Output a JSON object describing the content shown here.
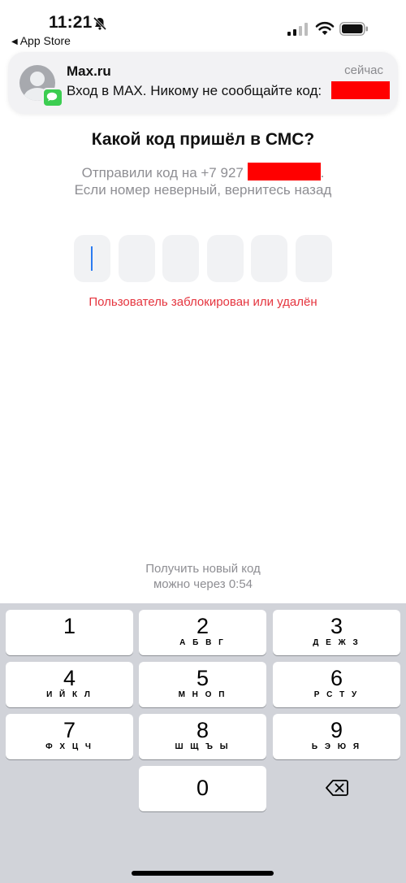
{
  "status_bar": {
    "time": "11:21",
    "back_label": "App Store",
    "icons": [
      "bell-slash-icon",
      "signal-icon",
      "wifi-icon",
      "battery-icon"
    ]
  },
  "notification": {
    "sender": "Max.ru",
    "time": "сейчас",
    "body": "Вход в MAX. Никому не сообщайте код:",
    "redaction_color": "#ff0000"
  },
  "main": {
    "title": "Какой код пришёл в СМС?",
    "sent_prefix": "Отправили код на +7 927",
    "sent_suffix": ".",
    "wrong_number": "Если номер неверный, вернитесь назад",
    "code_length": 6,
    "error": "Пользователь заблокирован или удалён",
    "resend_line1": "Получить новый код",
    "resend_line2": "можно через 0:54",
    "error_color": "#e5343e"
  },
  "keyboard": {
    "keys": [
      {
        "digit": "1",
        "letters": ""
      },
      {
        "digit": "2",
        "letters": "А Б В Г"
      },
      {
        "digit": "3",
        "letters": "Д Е Ж З"
      },
      {
        "digit": "4",
        "letters": "И Й К Л"
      },
      {
        "digit": "5",
        "letters": "М Н О П"
      },
      {
        "digit": "6",
        "letters": "Р С Т У"
      },
      {
        "digit": "7",
        "letters": "Ф Х Ц Ч"
      },
      {
        "digit": "8",
        "letters": "Ш Щ Ъ Ы"
      },
      {
        "digit": "9",
        "letters": "Ь Э Ю Я"
      },
      {
        "digit": "0",
        "letters": ""
      }
    ],
    "backspace_icon": "backspace-icon"
  }
}
